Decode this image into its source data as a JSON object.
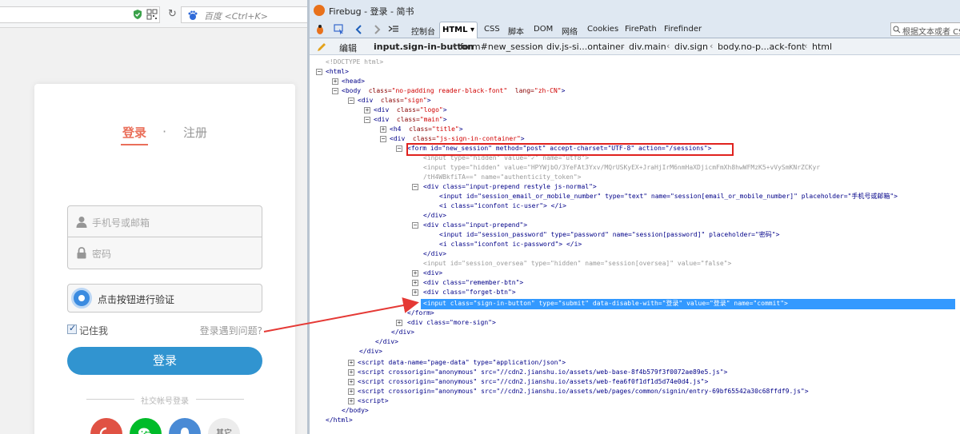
{
  "browser": {
    "search_placeholder": "百度 <Ctrl+K>"
  },
  "login": {
    "tab_login": "登录",
    "tab_separator": "·",
    "tab_register": "注册",
    "user_placeholder": "手机号或邮箱",
    "password_placeholder": "密码",
    "captcha_label": "点击按钮进行验证",
    "remember_label": "记住我",
    "problem_link": "登录遇到问题?",
    "login_button": "登录",
    "social_title": "社交帐号登录",
    "social_other": "其它",
    "colors": {
      "accent": "#ea6f5a",
      "button": "#3194d0",
      "weibo": "#e05244",
      "wechat": "#00bb29",
      "qq": "#498ad5"
    }
  },
  "firebug": {
    "window_title": "Firebug - 登录 - 简书",
    "tabs": [
      "控制台",
      "HTML ▾",
      "CSS",
      "脚本",
      "DOM",
      "网络",
      "Cookies",
      "FirePath",
      "Firefinder"
    ],
    "search_placeholder": "根据文本或者 CSS",
    "edit_label": "编辑",
    "breadcrumb": [
      "input.sign-in-button",
      "form#new_session",
      "div.js-si...ontainer",
      "div.main",
      "div.sign",
      "body.no-p...ack-font",
      "html"
    ],
    "code": {
      "doctype": "<!DOCTYPE html>",
      "html_open": "<html>",
      "head": "<head>",
      "body_tag": "<body",
      "body_a1": "class=",
      "body_v1": "\"no-padding reader-black-font\"",
      "body_a2": "lang=",
      "body_v2": "\"zh-CN\"",
      "div_sign": "\"sign\"",
      "div_logo": "\"logo\"",
      "div_main": "\"main\"",
      "h4_title": "\"title\"",
      "div_js": "\"js-sign-in-container\"",
      "form_line": "<form  id=\"new_session\"  method=\"post\"  accept-charset=\"UTF-8\"  action=\"/sessions\">",
      "hidden_utf8": "<input  type=\"hidden\"  value=\"✓\"  name=\"utf8\">",
      "hidden_token_1": "<input  type=\"hidden\"  value=\"HPYWjbO/3YeFAt3Yxv/MQrUSKyEX+JraHjIrM6nmHaXDjicmFmXh8hwWFMzK5+vVySmKNrZCKyr",
      "hidden_token_2": "/tH4WBkfiTA==\"  name=\"authenticity_token\">",
      "div_prepend_normal": "<div  class=\"input-prepend restyle js-normal\">",
      "input_email": "<input  id=\"session_email_or_mobile_number\"  type=\"text\"  name=\"session[email_or_mobile_number]\"  placeholder=\"手机号或邮箱\">",
      "i_user": "<i  class=\"iconfont ic-user\"> </i>",
      "div_close": "</div>",
      "div_prepend": "<div  class=\"input-prepend\">",
      "input_password": "<input  id=\"session_password\"  type=\"password\"  name=\"session[password]\"  placeholder=\"密码\">",
      "i_password": "<i  class=\"iconfont ic-password\"> </i>",
      "input_oversea": "<input  id=\"session_oversea\"  type=\"hidden\"  name=\"session[oversea]\"  value=\"false\">",
      "div_plain": "<div>",
      "div_remember": "<div  class=\"remember-btn\">",
      "div_forget": "<div  class=\"forget-btn\">",
      "input_signin": "<input  class=\"sign-in-button\"  type=\"submit\"  data-disable-with=\"登录\"  value=\"登录\"  name=\"commit\">",
      "form_close": "</form>",
      "div_more_sign": "<div  class=\"more-sign\">",
      "script_page_data": "<script  data-name=\"page-data\"  type=\"application/json\">",
      "script_1": "<script  crossorigin=\"anonymous\"  src=\"//cdn2.jianshu.io/assets/web-base-8f4b579f3f0072ae89e5.js\">",
      "script_2": "<script  crossorigin=\"anonymous\"  src=\"//cdn2.jianshu.io/assets/web-fea6f0f1df1d5d74e0d4.js\">",
      "script_3": "<script  crossorigin=\"anonymous\"  src=\"//cdn2.jianshu.io/assets/web/pages/common/signin/entry-69bf65542a30c68ffdf9.js\">",
      "script_plain": "<script>",
      "body_close": "</body>",
      "html_close": "</html>"
    }
  }
}
